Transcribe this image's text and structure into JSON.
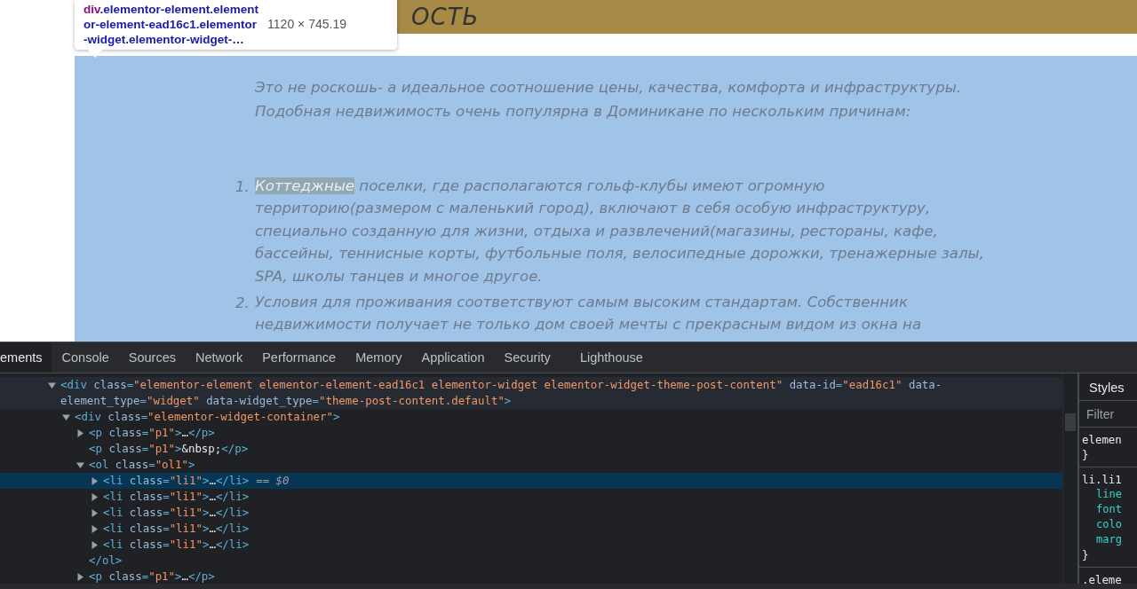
{
  "page": {
    "heading": "ОСТЬ",
    "tooltip": {
      "lines": [
        "div.elementor-element.element",
        "or-element-ead16c1.elementor",
        "-widget.elementor-widget-…"
      ],
      "size": "1120 × 745.19"
    },
    "intro_lines": [
      "Это не роскошь- а идеальное соотношение цены, качества, комфорта и инфраструктуры.",
      "Подобная недвижимость очень популярна в Доминикане по нескольким причинам:"
    ],
    "list": [
      {
        "number": "1.",
        "highlight": "Коттеджные",
        "lines": [
          " поселки, где располагаются гольф-клубы имеют огромную",
          "территорию(размером с маленький город), включают в себя особую инфраструктуру,",
          "специально созданную для жизни, отдыха и развлечений(магазины, рестораны, кафе,",
          "бассейны, теннисные корты, футбольные поля, велосипедные дорожки, тренажерные залы,",
          "SPA, школы танцев и многое другое."
        ]
      },
      {
        "number": "2.",
        "lines": [
          "Условия для проживания соответствуют самым высоким стандартам. Собственник",
          "недвижимости получает не только дом своей мечты с прекрасным видом из окна на"
        ]
      }
    ]
  },
  "devtools": {
    "tabs": [
      {
        "label": "ements",
        "selected": true
      },
      {
        "label": "Console",
        "selected": false
      },
      {
        "label": "Sources",
        "selected": false
      },
      {
        "label": "Network",
        "selected": false
      },
      {
        "label": "Performance",
        "selected": false
      },
      {
        "label": "Memory",
        "selected": false
      },
      {
        "label": "Application",
        "selected": false
      },
      {
        "label": "Security",
        "selected": false
      },
      {
        "label": "Lighthouse",
        "selected": false
      }
    ],
    "tree": [
      {
        "text": "<div class=\"elementor-element elementor-element-ead16c1 elementor-widget elementor-widget-theme-post-content\" data-id=\"ead16c1\" data-element_type=\"widget\" data-widget_type=\"theme-post-content.default\">",
        "expanded": true,
        "hovered": true,
        "selected": false,
        "children": [
          {
            "text": "<div class=\"elementor-widget-container\">",
            "expanded": true,
            "hovered": false,
            "selected": false,
            "children": [
              {
                "text": "<p class=\"p1\">…</p>",
                "expanded": false,
                "hovered": false,
                "selected": false
              },
              {
                "text": "<p class=\"p1\">&nbsp;</p>",
                "hovered": false,
                "selected": false
              },
              {
                "text": "<ol class=\"ol1\">",
                "expanded": true,
                "hovered": false,
                "selected": false,
                "closing": "</ol>",
                "children": [
                  {
                    "text": "<li class=\"li1\">…</li>",
                    "expanded": false,
                    "hovered": false,
                    "selected": true,
                    "suffix": "== $0"
                  },
                  {
                    "text": "<li class=\"li1\">…</li>",
                    "expanded": false,
                    "hovered": false,
                    "selected": false
                  },
                  {
                    "text": "<li class=\"li1\">…</li>",
                    "expanded": false,
                    "hovered": false,
                    "selected": false
                  },
                  {
                    "text": "<li class=\"li1\">…</li>",
                    "expanded": false,
                    "hovered": false,
                    "selected": false
                  },
                  {
                    "text": "<li class=\"li1\">…</li>",
                    "expanded": false,
                    "hovered": false,
                    "selected": false
                  }
                ]
              },
              {
                "text": "<p class=\"p1\">…</p>",
                "expanded": false,
                "hovered": false,
                "selected": false
              }
            ]
          }
        ]
      }
    ],
    "styles": {
      "tab": "Styles",
      "filter_placeholder": "Filter",
      "rules": [
        {
          "selector": "elemen",
          "close": "}"
        },
        {
          "selector": "li.li1",
          "properties": [
            "line",
            "font",
            "colo",
            "marg"
          ],
          "close": "}"
        },
        {
          "selector": ".eleme"
        }
      ]
    }
  }
}
